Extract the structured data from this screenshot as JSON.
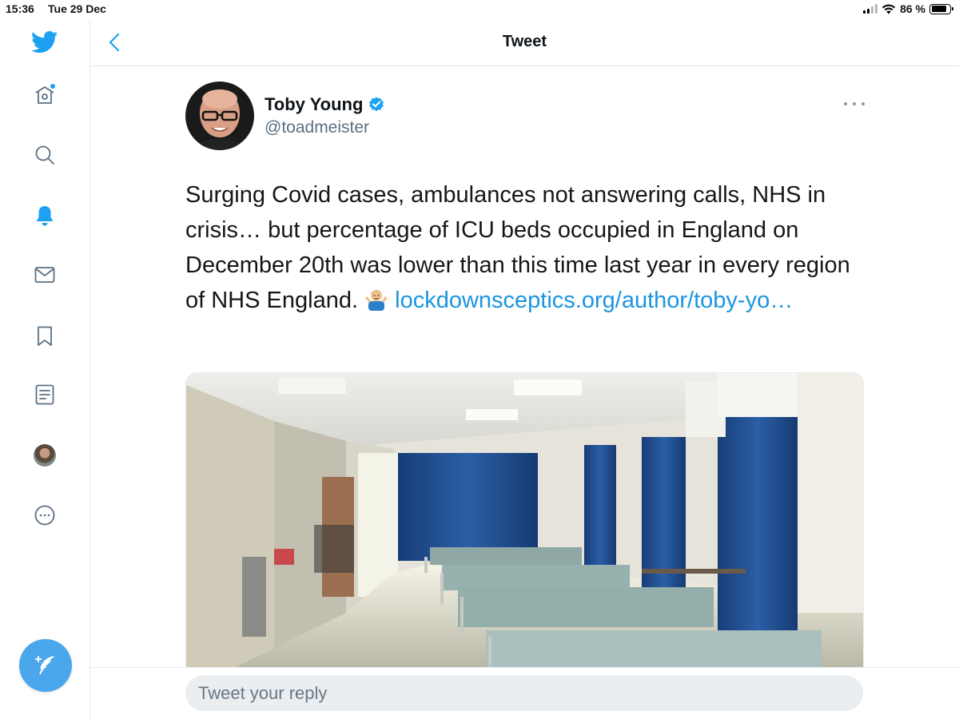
{
  "status_bar": {
    "time": "15:36",
    "date": "Tue 29 Dec",
    "battery": "86 %",
    "battery_level": 0.86
  },
  "header": {
    "title": "Tweet"
  },
  "sidebar": {
    "items": [
      {
        "icon": "twitter-logo-icon"
      },
      {
        "icon": "home-icon",
        "has_notification": true
      },
      {
        "icon": "search-icon"
      },
      {
        "icon": "notifications-bell-icon"
      },
      {
        "icon": "messages-envelope-icon"
      },
      {
        "icon": "bookmark-icon"
      },
      {
        "icon": "lists-icon"
      },
      {
        "icon": "profile-avatar"
      },
      {
        "icon": "more-icon"
      }
    ],
    "compose_icon": "compose-feather-icon"
  },
  "tweet": {
    "author_name": "Toby Young",
    "handle": "@toadmeister",
    "verified": true,
    "text": "Surging Covid cases, ambulances not answering calls, NHS in crisis… but percentage of ICU beds occupied in England on December 20th was lower than this time last year in every region of NHS England.",
    "emoji": "person-shrugging-emoji",
    "link": "lockdownsceptics.org/author/toby-yo…"
  },
  "reply": {
    "placeholder": "Tweet your reply"
  },
  "colors": {
    "accent": "#1da1f2",
    "link": "#1b95e0",
    "handle": "#5b7083",
    "reply_bg": "#ebeef0"
  }
}
